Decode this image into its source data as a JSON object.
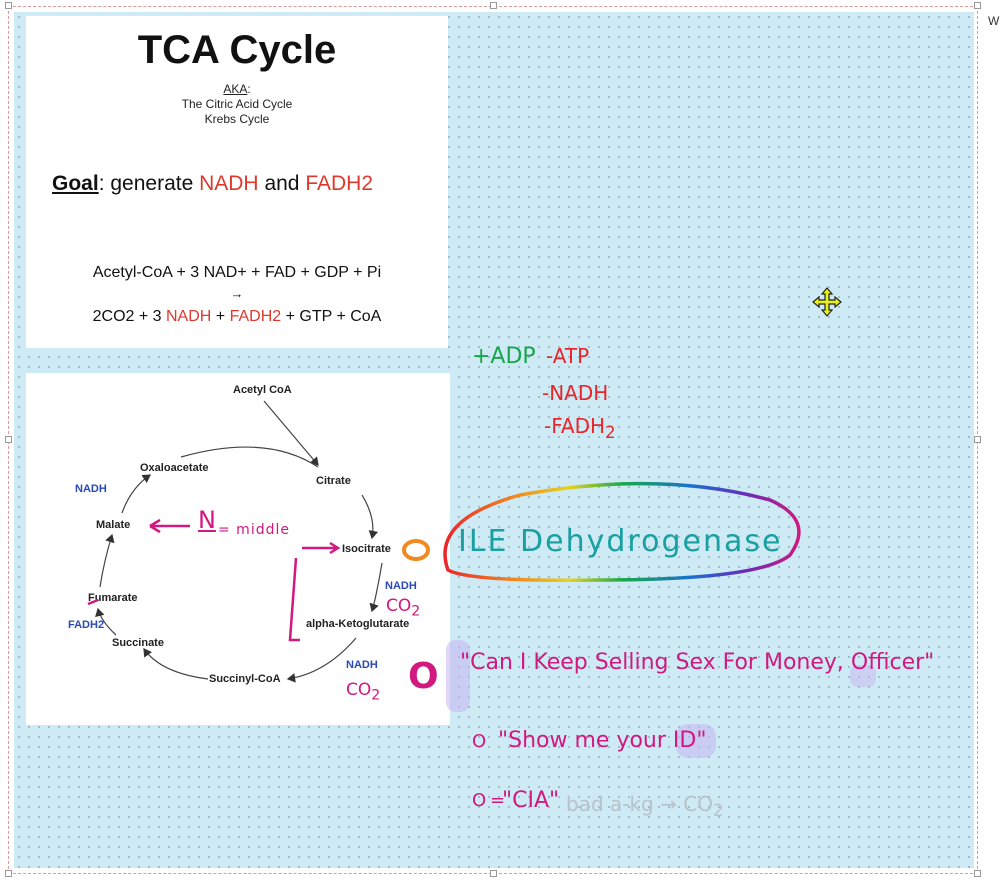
{
  "slide1": {
    "title": "TCA Cycle",
    "aka_label": "AKA",
    "aka_colon": ":",
    "aka_names": [
      "The Citric Acid Cycle",
      "Krebs Cycle"
    ],
    "goal_label": "Goal",
    "goal_text": ": generate ",
    "goal_nadh": "NADH",
    "goal_and": " and ",
    "goal_fadh2": "FADH2",
    "equation_reactants": "Acetyl-CoA + 3 NAD+ + FAD + GDP + Pi",
    "equation_arrow": "→",
    "equation_products": {
      "p1": "2CO2 + 3 ",
      "nadh": "NADH",
      "plus": " + ",
      "fadh2": "FADH2",
      "p2": " + GTP + CoA"
    }
  },
  "slide2": {
    "nodes": {
      "acetyl_coa": "Acetyl CoA",
      "citrate": "Citrate",
      "isocitrate": "Isocitrate",
      "akg": "alpha-Ketoglutarate",
      "succinyl_coa": "Succinyl-CoA",
      "succinate": "Succinate",
      "fumarate": "Fumarate",
      "malate": "Malate",
      "oxaloacetate": "Oxaloacetate"
    },
    "cofactors": {
      "nadh_top": "NADH",
      "nadh_iso": "NADH",
      "nadh_succ": "NADH",
      "fadh2": "FADH2"
    }
  },
  "handwriting": {
    "adp": "+ADP",
    "atp": "-ATP",
    "nadh": "-NADH",
    "fadh2": "-FADH",
    "fadh2_sub": "2",
    "dehydrogenase": "ILE Dehydrogenase",
    "n_label": "N",
    "middle": "= middle",
    "co2_1": "CO",
    "co2_2": "CO",
    "co2_sub": "2",
    "mnemonic1": "\"Can I Keep Selling Sex For Money, Officer\"",
    "mnemonic2": "\"Show me your ID\"",
    "mnemonic3": "\"CIA\"",
    "mnemonic3b": "bad  a-kg → CO",
    "mnemonic_o": "O",
    "eq_mark": "=",
    "corner_letter": "W"
  },
  "colors": {
    "canvas": "#cdeaf5",
    "red_text": "#e0382c",
    "blue_text": "#2a49b8",
    "ink_magenta": "#d1197f",
    "ink_green": "#18a64a",
    "ink_red": "#e8262b",
    "ink_purple": "#c9b4f0",
    "ink_gray": "#b8c2ca"
  }
}
